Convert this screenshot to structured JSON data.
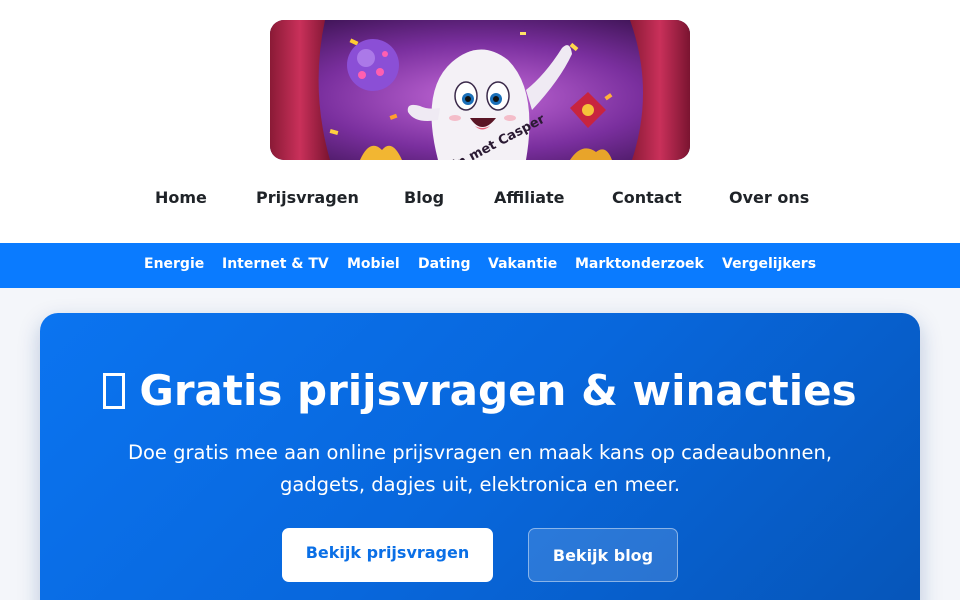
{
  "logo": {
    "banner_text": "Win met Casper"
  },
  "main_nav": {
    "items": [
      {
        "label": "Home"
      },
      {
        "label": "Prijsvragen"
      },
      {
        "label": "Blog"
      },
      {
        "label": "Affiliate"
      },
      {
        "label": "Contact"
      },
      {
        "label": "Over ons"
      }
    ]
  },
  "category_nav": {
    "items": [
      {
        "label": "Energie"
      },
      {
        "label": "Internet & TV"
      },
      {
        "label": "Mobiel"
      },
      {
        "label": "Dating"
      },
      {
        "label": "Vakantie"
      },
      {
        "label": "Marktonderzoek"
      },
      {
        "label": "Vergelijkers"
      }
    ]
  },
  "hero": {
    "title": "Gratis prijsvragen & winacties",
    "subtitle": "Doe gratis mee aan online prijsvragen en maak kans op cadeaubonnen, gadgets, dagjes uit, elektronica en meer.",
    "primary_button": "Bekijk prijsvragen",
    "secondary_button": "Bekijk blog"
  },
  "colors": {
    "accent": "#0a7bff",
    "hero_start": "#0b74f0",
    "hero_end": "#0655b8",
    "header_bg": "#ffffff"
  },
  "icons": {
    "hero_title_icon": "missing-glyph-icon"
  }
}
